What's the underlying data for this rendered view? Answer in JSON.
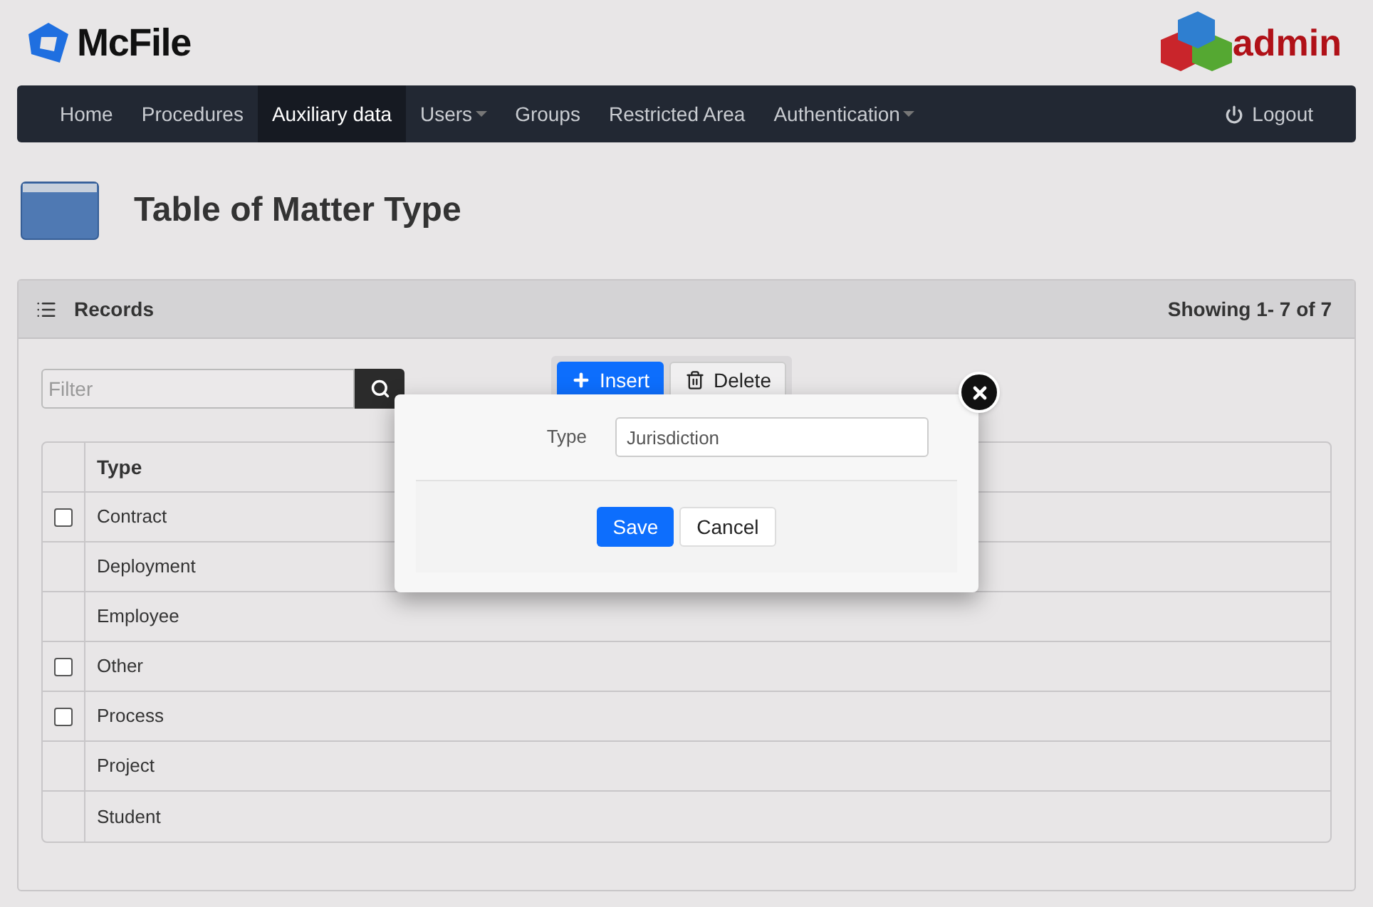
{
  "brand": {
    "name": "McFile",
    "badge": "admin"
  },
  "nav": {
    "items": [
      {
        "label": "Home",
        "selected": false,
        "dropdown": false
      },
      {
        "label": "Procedures",
        "selected": false,
        "dropdown": false
      },
      {
        "label": "Auxiliary data",
        "selected": true,
        "dropdown": false
      },
      {
        "label": "Users",
        "selected": false,
        "dropdown": true
      },
      {
        "label": "Groups",
        "selected": false,
        "dropdown": false
      },
      {
        "label": "Restricted Area",
        "selected": false,
        "dropdown": false
      },
      {
        "label": "Authentication",
        "selected": false,
        "dropdown": true
      }
    ],
    "logout": "Logout"
  },
  "page_title": "Table of Matter Type",
  "panel": {
    "title": "Records",
    "showing": "Showing 1- 7 of 7"
  },
  "filter": {
    "placeholder": "Filter"
  },
  "toolbar": [
    "Insert",
    "Delete"
  ],
  "table": {
    "columns": [
      "Type"
    ],
    "rows": [
      {
        "kind": "checkbox",
        "checked": false,
        "type": "Contract"
      },
      {
        "kind": "plain",
        "type": "Deployment"
      },
      {
        "kind": "plain",
        "type": "Employee"
      },
      {
        "kind": "checkbox",
        "checked": false,
        "type": "Other"
      },
      {
        "kind": "checkbox",
        "checked": false,
        "type": "Process"
      },
      {
        "kind": "plain",
        "type": "Project"
      },
      {
        "kind": "plain",
        "type": "Student"
      }
    ]
  },
  "dialog": {
    "label": "Type",
    "value": "Jurisdiction",
    "buttons": [
      "Save",
      "Cancel"
    ]
  }
}
